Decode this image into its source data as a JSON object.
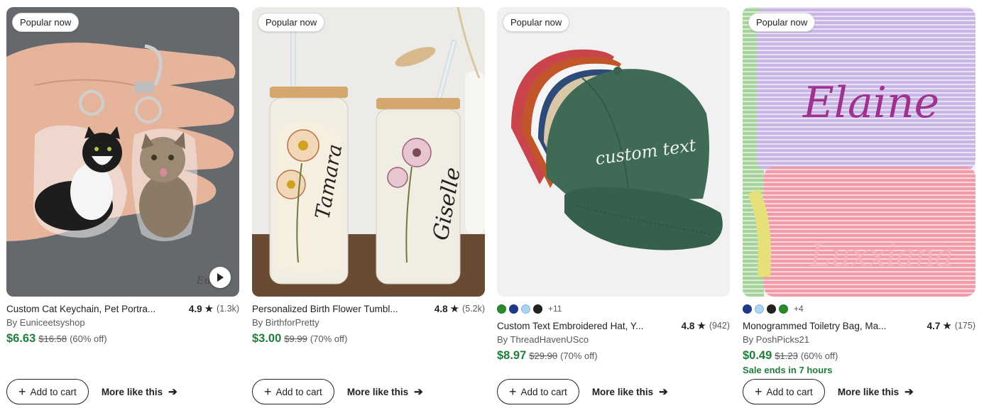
{
  "products": [
    {
      "badge": "Popular now",
      "title": "Custom Cat Keychain, Pet Portra...",
      "rating": "4.9",
      "reviews": "(1.3k)",
      "shop": "By Euniceetsyshop",
      "price": "$6.63",
      "original_price": "$16.58",
      "discount": "(60% off)",
      "watermark": "Eun",
      "add_to_cart": "Add to cart",
      "more_like_this": "More like this"
    },
    {
      "badge": "Popular now",
      "title": "Personalized Birth Flower Tumbl...",
      "rating": "4.8",
      "reviews": "(5.2k)",
      "shop": "By BirthforPretty",
      "price": "$3.00",
      "original_price": "$9.99",
      "discount": "(70% off)",
      "name_left": "Tamara",
      "name_right": "Giselle",
      "add_to_cart": "Add to cart",
      "more_like_this": "More like this"
    },
    {
      "badge": "Popular now",
      "swatch_colors": [
        "#2b8a2b",
        "#1f3a8a",
        "#a9d4f2",
        "#222222"
      ],
      "more_swatches": "+11",
      "title": "Custom Text Embroidered Hat, Y...",
      "rating": "4.8",
      "reviews": "(942)",
      "shop": "By ThreadHavenUSco",
      "price": "$8.97",
      "original_price": "$29.90",
      "discount": "(70% off)",
      "hat_text": "custom text",
      "add_to_cart": "Add to cart",
      "more_like_this": "More like this"
    },
    {
      "badge": "Popular now",
      "swatch_colors": [
        "#1f3a8a",
        "#a9d4f2",
        "#222222",
        "#2b8a2b"
      ],
      "more_swatches": "+4",
      "title": "Monogrammed Toiletry Bag, Ma...",
      "rating": "4.7",
      "reviews": "(175)",
      "shop": "By PoshPicks21",
      "price": "$0.49",
      "original_price": "$1.23",
      "discount": "(60% off)",
      "sale_text": "Sale ends in 7 hours",
      "name_top": "Elaine",
      "name_bottom": "Luxxiana",
      "add_to_cart": "Add to cart",
      "more_like_this": "More like this"
    }
  ],
  "colors": {
    "price_green": "#1e7d3a",
    "text": "#222222",
    "muted": "#595959"
  },
  "icons": {
    "rating": "star-icon",
    "add": "plus-icon",
    "more": "arrow-right-icon",
    "video": "play-icon"
  }
}
